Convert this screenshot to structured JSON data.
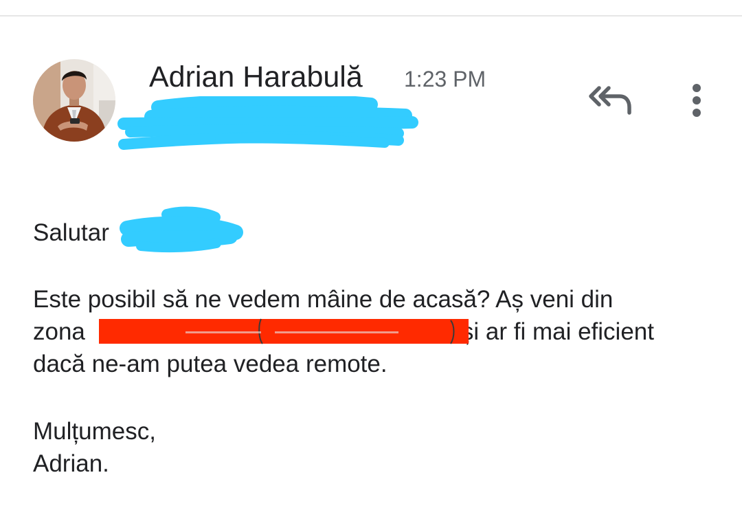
{
  "message": {
    "sender_name": "Adrian Harabulă",
    "time": "1:23 PM",
    "greeting": "Salutar",
    "body_line_1": "Este posibil să ne vedem mâine de acasă? Aș veni din",
    "body_line_2_start": "zona",
    "body_line_2_end": "și ar fi mai eficient",
    "body_line_3": "dacă ne-am putea vedea remote.",
    "closing": "Mulțumesc,",
    "signature": "Adrian."
  },
  "header_icons": {
    "reply_all": "reply-all-icon",
    "more": "more-vertical-icon"
  },
  "colors": {
    "redaction_blue": "#33ccff",
    "redaction_red": "#ff2a00",
    "icon_gray": "#5f6368",
    "text": "#202124"
  }
}
